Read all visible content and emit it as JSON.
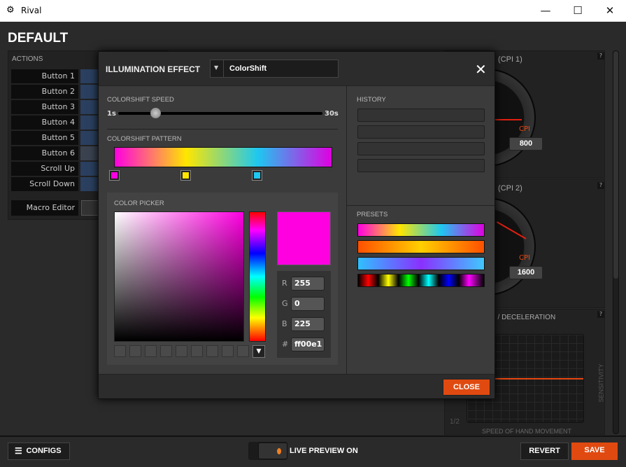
{
  "window": {
    "title": "Rival",
    "minimize": "—",
    "maximize": "☐",
    "close": "✕"
  },
  "page_title": "DEFAULT",
  "actions": {
    "label": "ACTIONS",
    "items": [
      "Button 1",
      "Button 2",
      "Button 3",
      "Button 4",
      "Button 5",
      "Button 6",
      "Scroll Up",
      "Scroll Down"
    ],
    "macro_editor": "Macro Editor"
  },
  "right": {
    "cpi1_title": "(CPI 1)",
    "cpi1_label": "CPI",
    "cpi1_value": "800",
    "cpi2_title": "(CPI 2)",
    "cpi2_label": "CPI",
    "cpi2_value": "1600",
    "accel_title": "I / DECELERATION",
    "y_axis": "SENSITIVITY",
    "x_axis": "SPEED OF HAND MOVEMENT",
    "page": "1/2",
    "help": "?"
  },
  "modal": {
    "title": "ILLUMINATION EFFECT",
    "effect": "ColorShift",
    "close_x": "✕",
    "speed_label": "COLORSHIFT SPEED",
    "speed_min": "1s",
    "speed_max": "30s",
    "speed_value_fraction": 0.18,
    "pattern_label": "COLORSHIFT PATTERN",
    "pattern_stops": [
      "#ff00e1",
      "#ffe600",
      "#1ec8f0"
    ],
    "picker_label": "COLOR PICKER",
    "selected_color": "#ff00e1",
    "rgb": {
      "r_label": "R",
      "r": "255",
      "g_label": "G",
      "g": "0",
      "b_label": "B",
      "b": "225",
      "hex_label": "#",
      "hex": "ff00e1"
    },
    "history_label": "HISTORY",
    "presets_label": "PRESETS",
    "close_label": "CLOSE"
  },
  "bottom": {
    "configs": "CONFIGS",
    "live_preview": "LIVE PREVIEW ON",
    "revert": "REVERT",
    "save": "SAVE"
  },
  "colors": {
    "accent": "#e8470f"
  }
}
